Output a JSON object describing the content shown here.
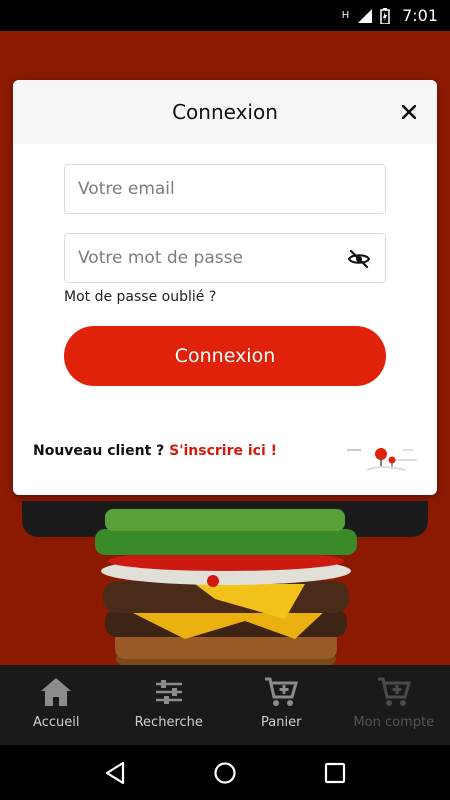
{
  "status_bar": {
    "time": "7:01",
    "signal": "H"
  },
  "modal": {
    "title": "Connexion",
    "email_placeholder": "Votre email",
    "password_placeholder": "Votre mot de passe",
    "forgot_password": "Mot de passe oublié ?",
    "login_button": "Connexion",
    "new_client": "Nouveau client ?",
    "signup_link": "S'inscrire ici !"
  },
  "bottom_nav": {
    "items": [
      {
        "label": "Accueil",
        "icon": "home-icon"
      },
      {
        "label": "Recherche",
        "icon": "sliders-icon"
      },
      {
        "label": "Panier",
        "icon": "cart-plus-icon"
      },
      {
        "label": "Mon compte",
        "icon": "cart-plus-icon"
      }
    ]
  },
  "colors": {
    "accent": "#e0220a",
    "background": "#8c1a00",
    "nav_bg": "#1a1a1a"
  }
}
